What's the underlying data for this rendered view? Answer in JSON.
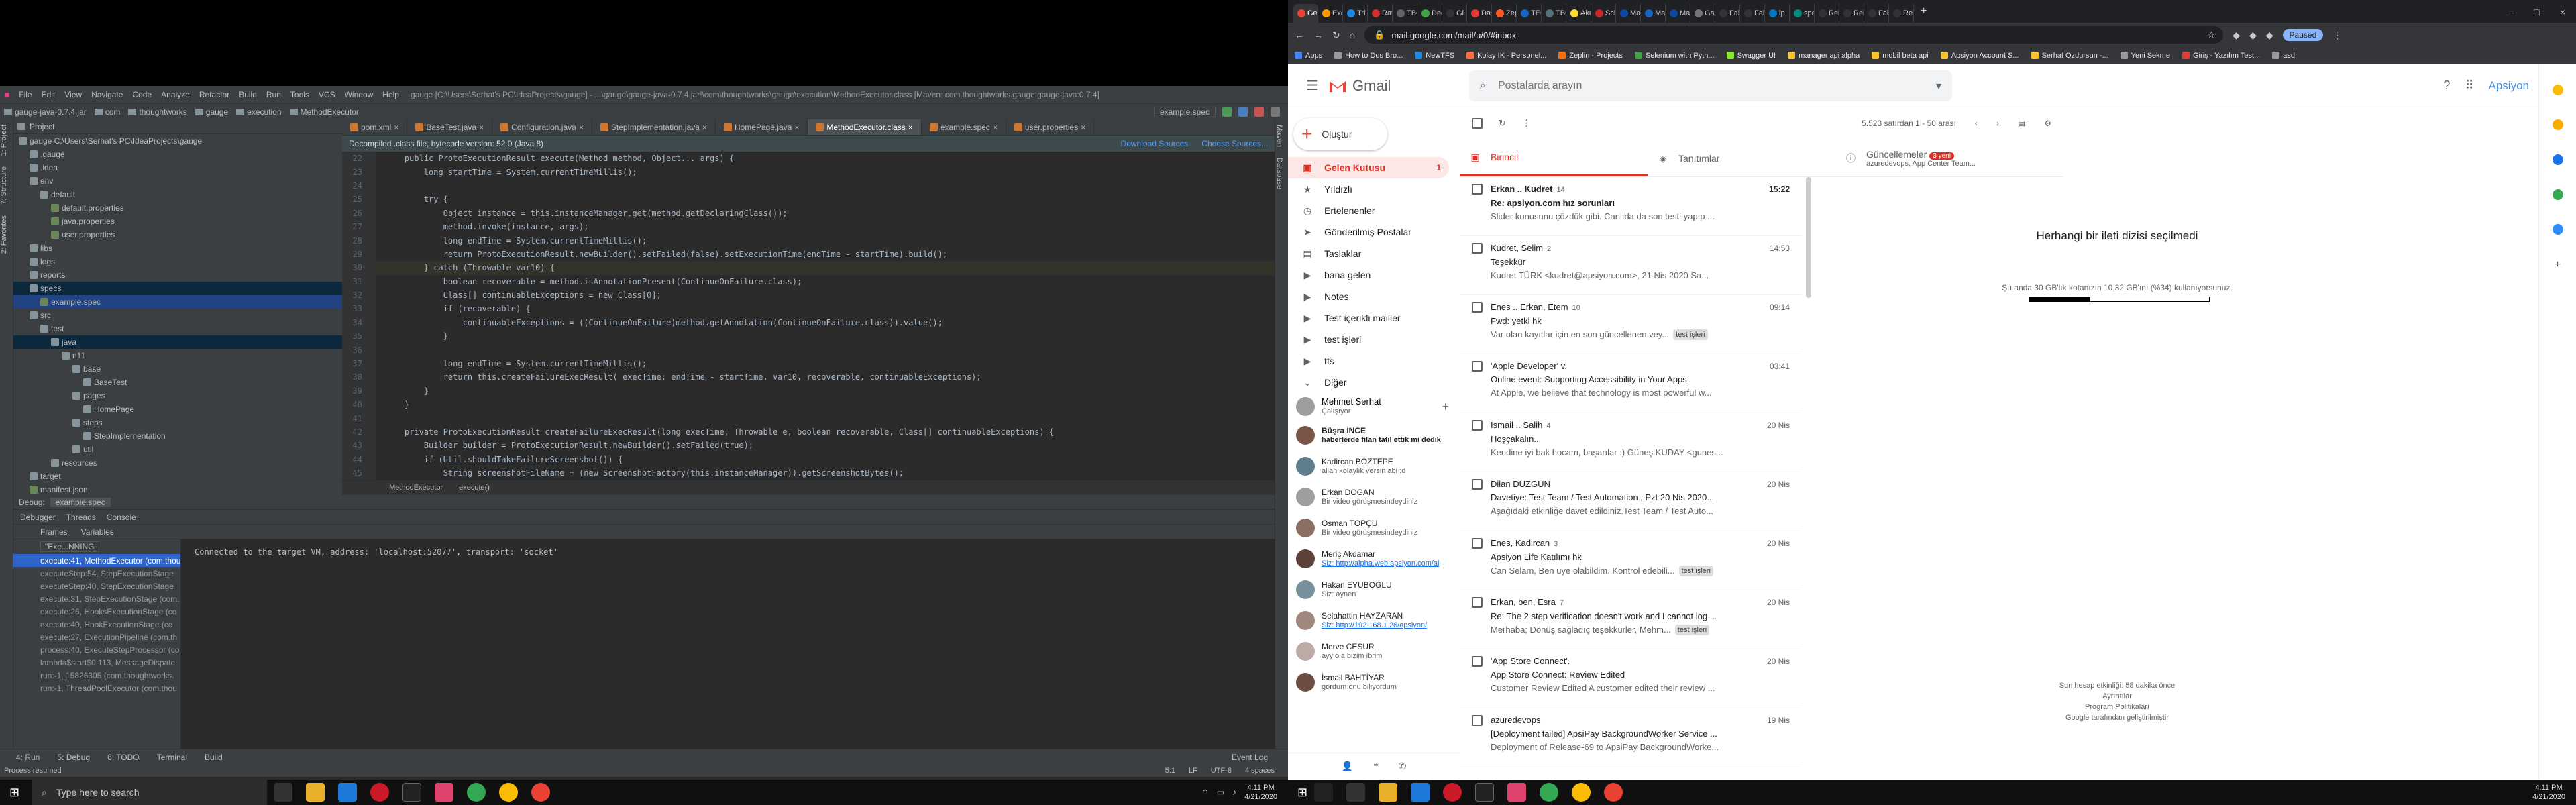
{
  "ide": {
    "title_menu": [
      "File",
      "Edit",
      "View",
      "Navigate",
      "Code",
      "Analyze",
      "Refactor",
      "Build",
      "Run",
      "Tools",
      "VCS",
      "Window",
      "Help"
    ],
    "title_path": "gauge [C:\\Users\\Serhat's PC\\IdeaProjects\\gauge] - ...\\gauge\\gauge-java-0.7.4.jar!\\com\\thoughtworks\\gauge\\execution\\MethodExecutor.class [Maven: com.thoughtworks.gauge:gauge-java:0.7.4]",
    "breadcrumb": [
      "gauge-java-0.7.4.jar",
      "com",
      "thoughtworks",
      "gauge",
      "execution",
      "MethodExecutor"
    ],
    "run_config": "example.spec",
    "project_label": "Project",
    "tree": [
      {
        "label": "gauge  C:\\Users\\Serhat's PC\\IdeaProjects\\gauge",
        "indent": 0
      },
      {
        "label": ".gauge",
        "indent": 1
      },
      {
        "label": ".idea",
        "indent": 1
      },
      {
        "label": "env",
        "indent": 1
      },
      {
        "label": "default",
        "indent": 2
      },
      {
        "label": "default.properties",
        "indent": 3
      },
      {
        "label": "java.properties",
        "indent": 3
      },
      {
        "label": "user.properties",
        "indent": 3
      },
      {
        "label": "libs",
        "indent": 1
      },
      {
        "label": "logs",
        "indent": 1
      },
      {
        "label": "reports",
        "indent": 1
      },
      {
        "label": "specs",
        "indent": 1,
        "sel": true
      },
      {
        "label": "example.spec",
        "indent": 2,
        "hl": true
      },
      {
        "label": "src",
        "indent": 1
      },
      {
        "label": "test",
        "indent": 2
      },
      {
        "label": "java",
        "indent": 3,
        "sel": true
      },
      {
        "label": "n11",
        "indent": 4
      },
      {
        "label": "base",
        "indent": 5
      },
      {
        "label": "BaseTest",
        "indent": 6
      },
      {
        "label": "pages",
        "indent": 5
      },
      {
        "label": "HomePage",
        "indent": 6
      },
      {
        "label": "steps",
        "indent": 5
      },
      {
        "label": "StepImplementation",
        "indent": 6
      },
      {
        "label": "util",
        "indent": 5
      },
      {
        "label": "resources",
        "indent": 3
      },
      {
        "label": "target",
        "indent": 1
      },
      {
        "label": "manifest.json",
        "indent": 1
      }
    ],
    "tabs": [
      "pom.xml",
      "BaseTest.java",
      "Configuration.java",
      "StepImplementation.java",
      "HomePage.java",
      "MethodExecutor.class",
      "example.spec",
      "user.properties"
    ],
    "active_tab": "MethodExecutor.class",
    "decompiled_msg": "Decompiled .class file, bytecode version: 52.0 (Java 8)",
    "download_sources": "Download Sources",
    "choose_sources": "Choose Sources...",
    "code": [
      {
        "n": "22",
        "t": "    public ProtoExecutionResult execute(Method method, Object... args) {"
      },
      {
        "n": "23",
        "t": "        long startTime = System.currentTimeMillis();"
      },
      {
        "n": "24",
        "t": ""
      },
      {
        "n": "25",
        "t": "        try {"
      },
      {
        "n": "26",
        "t": "            Object instance = this.instanceManager.get(method.getDeclaringClass());"
      },
      {
        "n": "27",
        "t": "            method.invoke(instance, args);"
      },
      {
        "n": "28",
        "t": "            long endTime = System.currentTimeMillis();"
      },
      {
        "n": "29",
        "t": "            return ProtoExecutionResult.newBuilder().setFailed(false).setExecutionTime(endTime - startTime).build();"
      },
      {
        "n": "30",
        "t": "        } catch (Throwable var10) {",
        "hl": true
      },
      {
        "n": "31",
        "t": "            boolean recoverable = method.isAnnotationPresent(ContinueOnFailure.class);"
      },
      {
        "n": "32",
        "t": "            Class[] continuableExceptions = new Class[0];"
      },
      {
        "n": "33",
        "t": "            if (recoverable) {"
      },
      {
        "n": "34",
        "t": "                continuableExceptions = ((ContinueOnFailure)method.getAnnotation(ContinueOnFailure.class)).value();"
      },
      {
        "n": "35",
        "t": "            }"
      },
      {
        "n": "36",
        "t": ""
      },
      {
        "n": "37",
        "t": "            long endTime = System.currentTimeMillis();"
      },
      {
        "n": "38",
        "t": "            return this.createFailureExecResult( execTime: endTime - startTime, var10, recoverable, continuableExceptions);"
      },
      {
        "n": "39",
        "t": "        }"
      },
      {
        "n": "40",
        "t": "    }"
      },
      {
        "n": "41",
        "t": ""
      },
      {
        "n": "42",
        "t": "    private ProtoExecutionResult createFailureExecResult(long execTime, Throwable e, boolean recoverable, Class[] continuableExceptions) {"
      },
      {
        "n": "43",
        "t": "        Builder builder = ProtoExecutionResult.newBuilder().setFailed(true);"
      },
      {
        "n": "44",
        "t": "        if (Util.shouldTakeFailureScreenshot()) {"
      },
      {
        "n": "45",
        "t": "            String screenshotFileName = (new ScreenshotFactory(this.instanceManager)).getScreenshotBytes();"
      }
    ],
    "editor_crumb": [
      "MethodExecutor",
      "execute()"
    ],
    "debug_label": "Debug:",
    "debug_config": "example.spec",
    "debug_tabs": [
      "Debugger",
      "Threads",
      "Console"
    ],
    "frames_label": "Frames",
    "variables_label": "Variables",
    "thread_select": "\"Exe...NNING",
    "frames": [
      "execute:41, MethodExecutor (com.thou",
      "executeStep:54, StepExecutionStage",
      "executeStep:40, StepExecutionStage",
      "execute:31, StepExecutionStage (com.",
      "execute:26, HooksExecutionStage (co",
      "execute:40, HookExecutionStage (co",
      "execute:27, ExecutionPipeline (com.th",
      "process:40, ExecuteStepProcessor (co",
      "lambda$start$0:113, MessageDispatc",
      "run:-1, 15826305 (com.thoughtworks.",
      "run:-1, ThreadPoolExecutor (com.thou"
    ],
    "console_text": "Connected to the target VM, address: 'localhost:52077', transport: 'socket'",
    "bottom_tabs": [
      "4: Run",
      "5: Debug",
      "6: TODO",
      "Terminal",
      "Build"
    ],
    "event_log": "Event Log",
    "status_msg": "Process resumed",
    "status_right": [
      "5:1",
      "LF",
      "UTF-8",
      "4 spaces"
    ]
  },
  "taskbar": {
    "search_placeholder": "Type here to search",
    "time": "4:11 PM",
    "date": "4/21/2020"
  },
  "chrome": {
    "url": "mail.google.com/mail/u/0/#inbox",
    "paused": "Paused",
    "tab_titles": [
      "Gelen",
      "Exe",
      "Tri",
      "Rat",
      "TBC",
      "Dec",
      "Gi",
      "Dav",
      "Zep",
      "TEC",
      "TBC",
      "Aku",
      "Sci",
      "Ma",
      "Ma",
      "Ma",
      "Gar",
      "Fai",
      "Fai",
      "ip",
      "spe",
      "Reb",
      "Reb",
      "Fai",
      "Reb"
    ],
    "bookmarks": [
      "Apps",
      "How to Dos Bro...",
      "NewTFS",
      "Kolay IK - Personel...",
      "Zeplin - Projects",
      "Selenium with Pyth...",
      "Swagger UI",
      "manager api alpha",
      "mobil beta api",
      "Apsiyon Account S...",
      "Serhat Ozdursun -...",
      "Yeni Sekme",
      "Giriş - Yazılım Test...",
      "asd"
    ]
  },
  "gmail": {
    "logo_text": "Gmail",
    "search_placeholder": "Postalarda arayın",
    "org_logo": "Apsiyon",
    "compose": "Oluştur",
    "nav": [
      {
        "label": "Gelen Kutusu",
        "count": "1",
        "active": true,
        "icon": "inbox-icon",
        "glyph": "▣"
      },
      {
        "label": "Yıldızlı",
        "icon": "star-icon",
        "glyph": "★"
      },
      {
        "label": "Ertelenenler",
        "icon": "clock-icon",
        "glyph": "◷"
      },
      {
        "label": "Gönderilmiş Postalar",
        "icon": "send-icon",
        "glyph": "➤"
      },
      {
        "label": "Taslaklar",
        "icon": "draft-icon",
        "glyph": "▤"
      },
      {
        "label": "bana gelen",
        "icon": "label-icon",
        "glyph": "▶"
      },
      {
        "label": "Notes",
        "icon": "label-icon",
        "glyph": "▶"
      },
      {
        "label": "Test içerikli mailler",
        "icon": "label-icon",
        "glyph": "▶"
      },
      {
        "label": "test işleri",
        "icon": "label-icon",
        "glyph": "▶"
      },
      {
        "label": "tfs",
        "icon": "label-icon",
        "glyph": "▶"
      },
      {
        "label": "Diğer",
        "icon": "chevron-down-icon",
        "glyph": "⌄"
      }
    ],
    "hangouts_self": {
      "name": "Mehmet Serhat",
      "status": "Çalışıyor"
    },
    "hangouts": [
      {
        "name": "Büşra İNCE",
        "sub": "haberlerde filan tatil ettik mi dedik",
        "bold": true
      },
      {
        "name": "Kadircan BÖZTEPE",
        "sub": "allah kolaylık versin abi :d"
      },
      {
        "name": "Erkan DOGAN",
        "sub": "Bir video görüşmesindeydiniz"
      },
      {
        "name": "Osman TOPÇU",
        "sub": "Bir video görüşmesindeydiniz"
      },
      {
        "name": "Meriç Akdamar",
        "sub": "Siz: http://alpha.web.apsiyon.com/al",
        "link": true
      },
      {
        "name": "Hakan EYUBOGLU",
        "sub": "Siz: aynen"
      },
      {
        "name": "Selahattin HAYZARAN",
        "sub": "Siz: http://192.168.1.26/apsiyon/",
        "link": true
      },
      {
        "name": "Merve CESUR",
        "sub": "ayy ola bizim ibrim"
      },
      {
        "name": "İsmail BAHTİYAR",
        "sub": "gordum onu biliyordum"
      }
    ],
    "range": "5.523 satırdan 1 - 50 arası",
    "categories": [
      {
        "label": "Birincil",
        "icon": "inbox-icon",
        "active": true
      },
      {
        "label": "Tanıtımlar",
        "icon": "tag-icon"
      },
      {
        "label": "Güncellemeler",
        "icon": "info-icon",
        "badge": "3 yeni",
        "sub": "azuredevops, App Center Team..."
      }
    ],
    "mails": [
      {
        "from": "Erkan .. Kudret",
        "count": "14",
        "time": "15:22",
        "subject": "Re: apsiyon.com hız sorunları",
        "snippet": "Slider konusunu çözdük gibi. Canlıda da son testi yapıp ...",
        "unread": true
      },
      {
        "from": "Kudret, Selim",
        "count": "2",
        "time": "14:53",
        "subject": "Teşekkür",
        "snippet": "Kudret TÜRK <kudret@apsiyon.com>, 21 Nis 2020 Sa..."
      },
      {
        "from": "Enes .. Erkan, Etem",
        "count": "10",
        "time": "09:14",
        "subject": "Fwd: yetki hk",
        "snippet": "Var olan kayıtlar için en son güncellenen vey...",
        "label": "test işleri"
      },
      {
        "from": "'Apple Developer' v.",
        "count": "",
        "time": "03:41",
        "subject": "Online event: Supporting Accessibility in Your Apps",
        "snippet": "At Apple, we believe that technology is most powerful w..."
      },
      {
        "from": "İsmail .. Salih",
        "count": "4",
        "time": "20 Nis",
        "subject": "Hoşçakalın...",
        "snippet": "Kendine iyi bak hocam, başarılar :) Güneş KUDAY <gunes..."
      },
      {
        "from": "Dilan DÜZGÜN",
        "count": "",
        "time": "20 Nis",
        "subject": "Davetiye: Test Team / Test Automation , Pzt 20 Nis 2020...",
        "snippet": "Aşağıdaki etkinliğe davet edildiniz.Test Team / Test Auto..."
      },
      {
        "from": "Enes, Kadircan",
        "count": "3",
        "time": "20 Nis",
        "subject": "Apsiyon Life Katılımı hk",
        "snippet": "Can Selam, Ben üye olabildim. Kontrol edebili...",
        "label": "test işleri"
      },
      {
        "from": "Erkan, ben, Esra",
        "count": "7",
        "time": "20 Nis",
        "subject": "Re: The 2 step verification doesn't work and I cannot log ...",
        "snippet": "Merhaba; Dönüş sağladıç teşekkürler, Mehm...",
        "label": "test işleri"
      },
      {
        "from": "'App Store Connect'.",
        "count": "",
        "time": "20 Nis",
        "subject": "App Store Connect: Review Edited",
        "snippet": "Customer Review Edited A customer edited their review ..."
      },
      {
        "from": "azuredevops",
        "count": "",
        "time": "19 Nis",
        "subject": "[Deployment failed] ApsiPay BackgroundWorker Service ...",
        "snippet": "Deployment of Release-69 to ApsiPay BackgroundWorke..."
      }
    ],
    "no_selection": "Herhangi bir ileti dizisi seçilmedi",
    "quota_text": "Şu anda 30 GB'lık kotanızın 10,32 GB'ını (%34) kullanıyorsunuz.",
    "quota_fraction": 0.34,
    "footer": [
      "Son hesap etkinliği: 58 dakika önce",
      "Ayrıntılar",
      "Program Politikaları",
      "Google tarafından geliştirilmiştir"
    ]
  }
}
